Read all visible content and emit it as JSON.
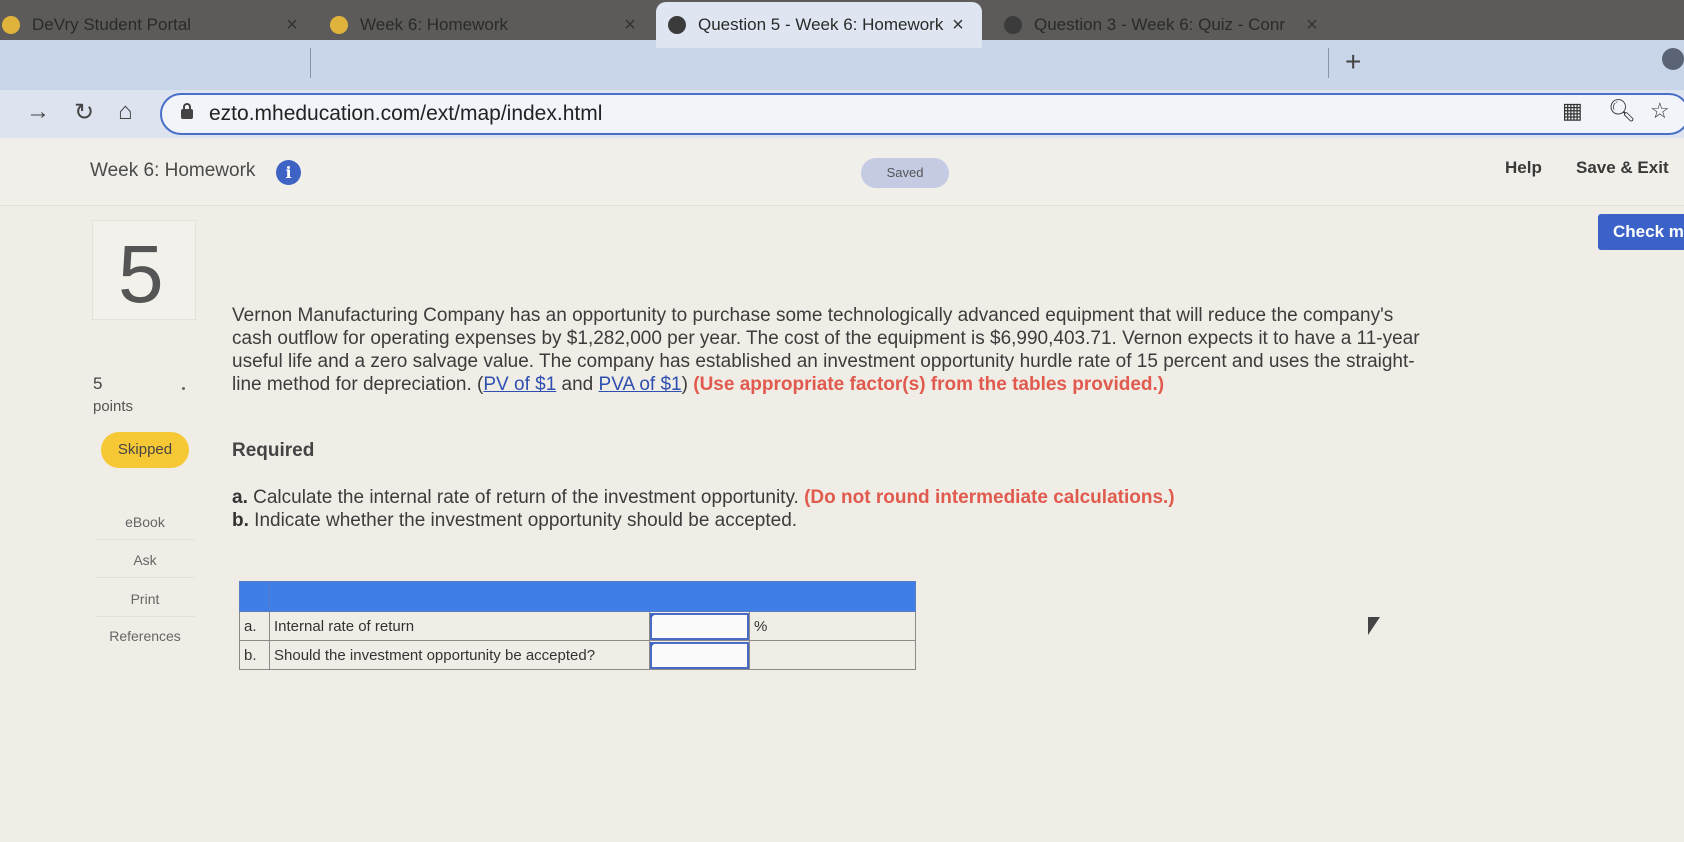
{
  "browser": {
    "tabs": [
      {
        "title": "DeVry Student Portal",
        "close": "×",
        "icon_color": "#e0b43c"
      },
      {
        "title": "Week 6: Homework",
        "close": "×",
        "icon_color": "#e0b43c"
      },
      {
        "title": "Question 5 - Week 6: Homework",
        "close": "×",
        "icon_color": "#3b3b3b"
      },
      {
        "title": "Question 3 - Week 6: Quiz - Conr",
        "close": "×",
        "icon_color": "#3b3b3b"
      }
    ],
    "new_tab": "+",
    "url": "ezto.mheducation.com/ext/map/index.html"
  },
  "header": {
    "title": "Week 6: Homework",
    "info": "i",
    "saved": "Saved",
    "help": "Help",
    "save_exit": "Save & Exit",
    "check": "Check m"
  },
  "sidebar": {
    "question_number": "5",
    "points_value": "5",
    "points_label": "points",
    "status": "Skipped",
    "links": [
      "eBook",
      "Ask",
      "Print",
      "References"
    ]
  },
  "question": {
    "text": "Vernon Manufacturing Company has an opportunity to purchase some technologically advanced equipment that will reduce the company's cash outflow for operating expenses by $1,282,000 per year. The cost of the equipment is $6,990,403.71. Vernon expects it to have a 11-year useful life and a zero salvage value. The company has established an investment opportunity hurdle rate of 15 percent and uses the straight-line method for depreciation. (",
    "link_pv": "PV of $1",
    "and": " and ",
    "link_pva": "PVA of $1",
    "close_paren": ") ",
    "note": "(Use appropriate factor(s) from the tables provided.)",
    "required_label": "Required",
    "part_a_letter": "a.",
    "part_a": " Calculate the internal rate of return of the investment opportunity. ",
    "part_a_note": "(Do not round intermediate calculations.)",
    "part_b_letter": "b.",
    "part_b": " Indicate whether the investment opportunity should be accepted."
  },
  "answer_table": {
    "rows": [
      {
        "idx": "a.",
        "label": "Internal rate of return",
        "value": "",
        "unit": "%"
      },
      {
        "idx": "b.",
        "label": "Should the investment opportunity be accepted?",
        "value": "",
        "unit": ""
      }
    ]
  }
}
